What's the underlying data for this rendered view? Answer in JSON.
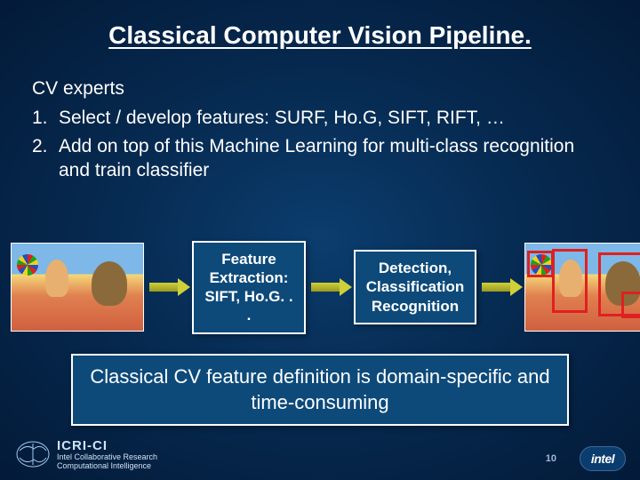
{
  "title": "Classical Computer Vision Pipeline.",
  "subtitle": "CV experts",
  "items": [
    {
      "num": "1.",
      "text": "Select / develop features:  SURF, Ho.G, SIFT, RIFT, …"
    },
    {
      "num": "2.",
      "text": "Add on top of this Machine Learning for multi-class recognition and train classifier"
    }
  ],
  "stage1": {
    "l1": "Feature",
    "l2": "Extraction:",
    "l3": "SIFT, Ho.G. . ."
  },
  "stage2": {
    "l1": "Detection,",
    "l2": "Classification",
    "l3": "Recognition"
  },
  "summary": "Classical CV feature definition is domain-specific and time-consuming",
  "logo": {
    "main": "ICRI-CI",
    "sub1": "Intel Collaborative Research",
    "sub2": "Computational Intelligence"
  },
  "page_number": "10",
  "brand": "intel"
}
